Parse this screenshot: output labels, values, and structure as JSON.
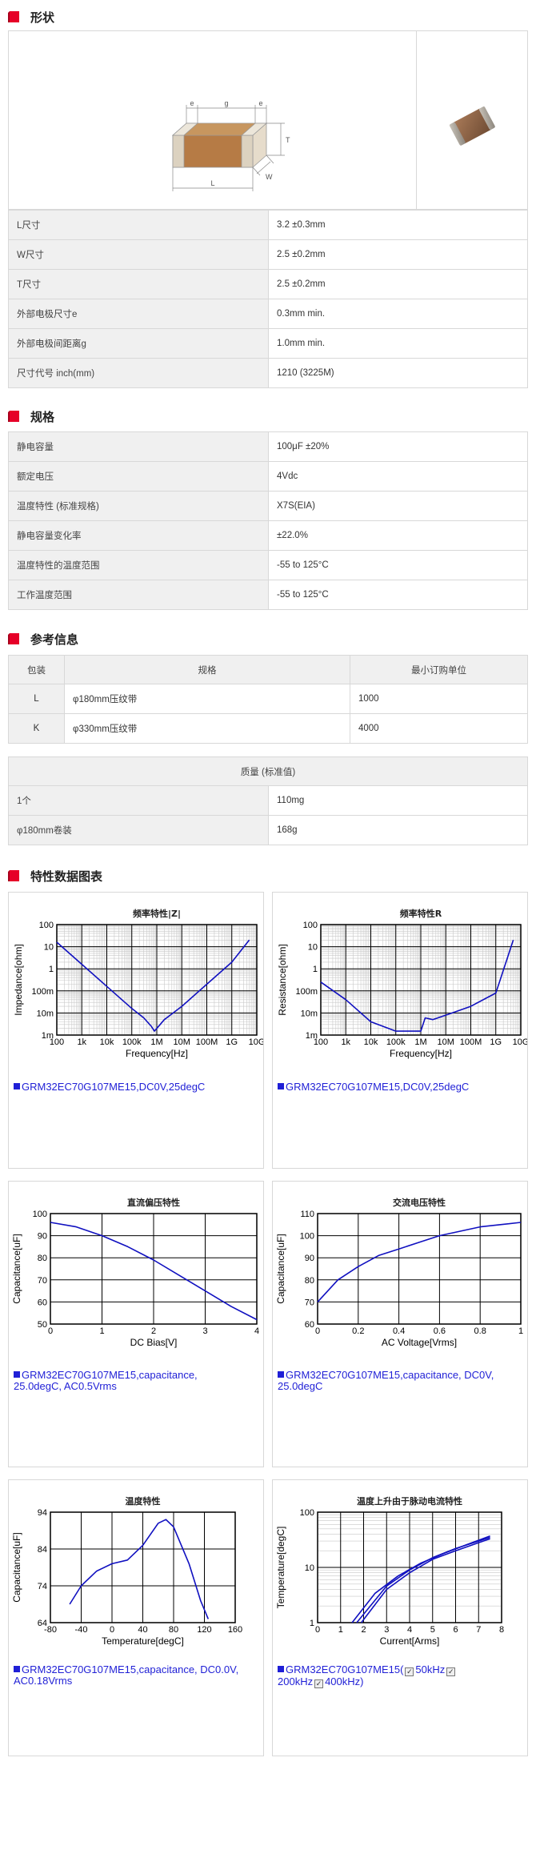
{
  "sections": {
    "shape": "形状",
    "spec": "规格",
    "ref": "参考信息",
    "charts": "特性数据图表"
  },
  "dimension_labels": {
    "e1": "e",
    "g": "g",
    "e2": "e",
    "T": "T",
    "W": "W",
    "L": "L"
  },
  "shape_table": [
    {
      "k": "L尺寸",
      "v": "3.2 ±0.3mm"
    },
    {
      "k": "W尺寸",
      "v": "2.5 ±0.2mm"
    },
    {
      "k": "T尺寸",
      "v": "2.5 ±0.2mm"
    },
    {
      "k": "外部电极尺寸e",
      "v": "0.3mm min."
    },
    {
      "k": "外部电极间距离g",
      "v": "1.0mm min."
    },
    {
      "k": "尺寸代号 inch(mm)",
      "v": "1210 (3225M)"
    }
  ],
  "spec_table": [
    {
      "k": "静电容量",
      "v": "100μF ±20%"
    },
    {
      "k": "额定电压",
      "v": "4Vdc"
    },
    {
      "k": "温度特性 (标准规格)",
      "v": "X7S(EIA)"
    },
    {
      "k": "静电容量变化率",
      "v": "±22.0%"
    },
    {
      "k": "温度特性的温度范围",
      "v": "-55 to 125°C"
    },
    {
      "k": "工作温度范围",
      "v": "-55 to 125°C"
    }
  ],
  "pack_table": {
    "headers": [
      "包装",
      "规格",
      "最小订购单位"
    ],
    "rows": [
      [
        "L",
        "φ180mm压纹带",
        "1000"
      ],
      [
        "K",
        "φ330mm压纹带",
        "4000"
      ]
    ]
  },
  "mass_table": {
    "header": "质量 (标准值)",
    "rows": [
      {
        "k": "1个",
        "v": "110mg"
      },
      {
        "k": "φ180mm卷装",
        "v": "168g"
      }
    ]
  },
  "charts": {
    "c1": {
      "title": "频率特性|Z|",
      "ylabel": "Impedance[ohm]",
      "xlabel": "Frequency[Hz]",
      "yticks": [
        "100",
        "10",
        "1",
        "100m",
        "10m",
        "1m"
      ],
      "xticks": [
        "100",
        "1k",
        "10k",
        "100k",
        "1M",
        "10M",
        "100M",
        "1G",
        "10G"
      ],
      "legend": "GRM32EC70G107ME15,DC0V,25degC"
    },
    "c2": {
      "title": "频率特性R",
      "ylabel": "Resistance[ohm]",
      "xlabel": "Frequency[Hz]",
      "yticks": [
        "100",
        "10",
        "1",
        "100m",
        "10m",
        "1m"
      ],
      "xticks": [
        "100",
        "1k",
        "10k",
        "100k",
        "1M",
        "10M",
        "100M",
        "1G",
        "10G"
      ],
      "legend": "GRM32EC70G107ME15,DC0V,25degC"
    },
    "c3": {
      "title": "直流偏压特性",
      "ylabel": "Capacitance[uF]",
      "xlabel": "DC Bias[V]",
      "yticks": [
        "100",
        "90",
        "80",
        "70",
        "60",
        "50"
      ],
      "xticks": [
        "0",
        "1",
        "2",
        "3",
        "4"
      ],
      "legend": "GRM32EC70G107ME15,capacitance, 25.0degC, AC0.5Vrms"
    },
    "c4": {
      "title": "交流电压特性",
      "ylabel": "Capacitance[uF]",
      "xlabel": "AC Voltage[Vrms]",
      "yticks": [
        "110",
        "100",
        "90",
        "80",
        "70",
        "60"
      ],
      "xticks": [
        "0",
        "0.2",
        "0.4",
        "0.6",
        "0.8",
        "1"
      ],
      "legend": "GRM32EC70G107ME15,capacitance, DC0V, 25.0degC"
    },
    "c5": {
      "title": "温度特性",
      "ylabel": "Capacitance[uF]",
      "xlabel": "Temperature[degC]",
      "yticks": [
        "94",
        "84",
        "74",
        "64"
      ],
      "xticks": [
        "-80",
        "-40",
        "0",
        "40",
        "80",
        "120",
        "160"
      ],
      "legend": "GRM32EC70G107ME15,capacitance, DC0.0V, AC0.18Vrms"
    },
    "c6": {
      "title": "温度上升由于脉动电流特性",
      "ylabel": "Temperature[degC]",
      "xlabel": "Current[Arms]",
      "yticks": [
        "100",
        "10",
        "1"
      ],
      "xticks": [
        "0",
        "1",
        "2",
        "3",
        "4",
        "5",
        "6",
        "7",
        "8"
      ],
      "legend_a": "GRM32EC70G107ME15(",
      "legend_b": "50kHz",
      "legend_c": "200kHz",
      "legend_d": "400kHz)"
    }
  },
  "chart_data": [
    {
      "type": "line",
      "title": "频率特性|Z|",
      "xlabel": "Frequency[Hz]",
      "ylabel": "Impedance[ohm]",
      "xscale": "log",
      "yscale": "log",
      "xlim": [
        100,
        10000000000
      ],
      "ylim": [
        0.001,
        100
      ],
      "series": [
        {
          "name": "GRM32EC70G107ME15,DC0V,25degC",
          "x": [
            100,
            1000,
            10000,
            100000,
            300000,
            600000,
            800000,
            1000000,
            2000000,
            10000000,
            100000000,
            1000000000,
            5000000000
          ],
          "y": [
            16,
            1.6,
            0.16,
            0.016,
            0.006,
            0.0025,
            0.0015,
            0.002,
            0.005,
            0.02,
            0.2,
            2,
            20
          ]
        }
      ]
    },
    {
      "type": "line",
      "title": "频率特性R",
      "xlabel": "Frequency[Hz]",
      "ylabel": "Resistance[ohm]",
      "xscale": "log",
      "yscale": "log",
      "xlim": [
        100,
        10000000000
      ],
      "ylim": [
        0.001,
        100
      ],
      "series": [
        {
          "name": "GRM32EC70G107ME15,DC0V,25degC",
          "x": [
            100,
            1000,
            10000,
            100000,
            1000000,
            1500000,
            3000000,
            10000000,
            100000000,
            1000000000,
            5000000000
          ],
          "y": [
            0.25,
            0.04,
            0.004,
            0.0015,
            0.0015,
            0.006,
            0.005,
            0.008,
            0.02,
            0.08,
            20
          ]
        }
      ]
    },
    {
      "type": "line",
      "title": "直流偏压特性",
      "xlabel": "DC Bias[V]",
      "ylabel": "Capacitance[uF]",
      "xlim": [
        0,
        4
      ],
      "ylim": [
        50,
        100
      ],
      "series": [
        {
          "name": "GRM32EC70G107ME15,capacitance, 25.0degC, AC0.5Vrms",
          "x": [
            0,
            0.5,
            1,
            1.5,
            2,
            2.5,
            3,
            3.5,
            4
          ],
          "y": [
            96,
            94,
            90,
            85,
            79,
            72,
            65,
            58,
            52
          ]
        }
      ]
    },
    {
      "type": "line",
      "title": "交流电压特性",
      "xlabel": "AC Voltage[Vrms]",
      "ylabel": "Capacitance[uF]",
      "xlim": [
        0,
        1
      ],
      "ylim": [
        60,
        110
      ],
      "series": [
        {
          "name": "GRM32EC70G107ME15,capacitance, DC0V, 25.0degC",
          "x": [
            0,
            0.1,
            0.2,
            0.3,
            0.4,
            0.5,
            0.6,
            0.7,
            0.8,
            0.9,
            1
          ],
          "y": [
            70,
            80,
            86,
            91,
            94,
            97,
            100,
            102,
            104,
            105,
            106
          ]
        }
      ]
    },
    {
      "type": "line",
      "title": "温度特性",
      "xlabel": "Temperature[degC]",
      "ylabel": "Capacitance[uF]",
      "xlim": [
        -80,
        160
      ],
      "ylim": [
        64,
        94
      ],
      "series": [
        {
          "name": "GRM32EC70G107ME15,capacitance, DC0.0V, AC0.18Vrms",
          "x": [
            -55,
            -40,
            -20,
            0,
            20,
            40,
            60,
            70,
            80,
            100,
            115,
            125
          ],
          "y": [
            69,
            74,
            78,
            80,
            81,
            85,
            91,
            92,
            90,
            80,
            70,
            65
          ]
        }
      ]
    },
    {
      "type": "line",
      "title": "温度上升由于脉动电流特性",
      "xlabel": "Current[Arms]",
      "ylabel": "Temperature[degC]",
      "xlim": [
        0,
        8
      ],
      "yscale": "log",
      "ylim": [
        1,
        100
      ],
      "series": [
        {
          "name": "50kHz",
          "x": [
            1.9,
            3,
            4,
            5,
            6,
            7,
            7.5
          ],
          "y": [
            1,
            4,
            8,
            14,
            20,
            28,
            33
          ]
        },
        {
          "name": "200kHz",
          "x": [
            1.7,
            3,
            4,
            5,
            6,
            7,
            7.5
          ],
          "y": [
            1,
            4.6,
            9,
            15,
            22,
            30,
            35
          ]
        },
        {
          "name": "400kHz",
          "x": [
            1.5,
            2.5,
            3.5,
            4.5,
            5.5,
            6.5,
            7.5
          ],
          "y": [
            1,
            3.4,
            7,
            12,
            18,
            26,
            37
          ]
        }
      ]
    }
  ]
}
